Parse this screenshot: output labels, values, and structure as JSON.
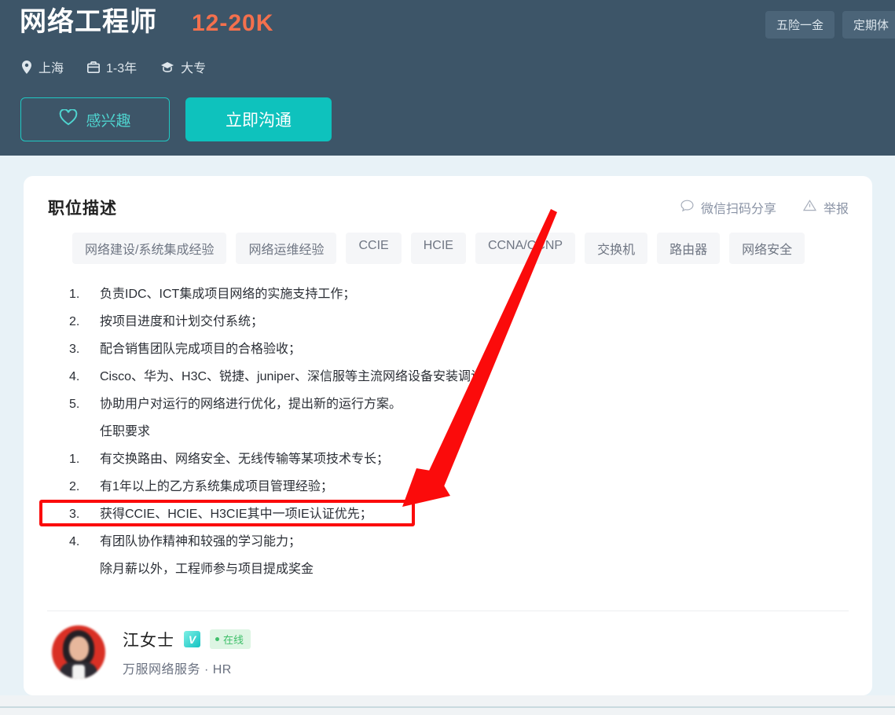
{
  "header": {
    "job_title": "网络工程师",
    "salary": "12-20K",
    "meta": [
      {
        "icon": "location-pin-icon",
        "label": "上海"
      },
      {
        "icon": "briefcase-icon",
        "label": "1-3年"
      },
      {
        "icon": "graduation-cap-icon",
        "label": "大专"
      }
    ],
    "benefit_badges": [
      "五险一金",
      "定期体"
    ],
    "interest_button": "感兴趣",
    "chat_button": "立即沟通",
    "bg_color": "#3d5568",
    "salary_color": "#f4704d",
    "accent_color": "#0ec2bd"
  },
  "card": {
    "section_title": "职位描述",
    "actions": [
      {
        "icon": "chat-bubble-icon",
        "label": "微信扫码分享"
      },
      {
        "icon": "warning-triangle-icon",
        "label": "举报"
      }
    ],
    "tags": [
      "网络建设/系统集成经验",
      "网络运维经验",
      "CCIE",
      "HCIE",
      "CCNA/CCNP",
      "交换机",
      "路由器",
      "网络安全"
    ],
    "description_lines": [
      {
        "num": "1.",
        "text": "负责IDC、ICT集成项目网络的实施支持工作；"
      },
      {
        "num": "2.",
        "text": "按项目进度和计划交付系统；"
      },
      {
        "num": "3.",
        "text": "配合销售团队完成项目的合格验收；"
      },
      {
        "num": "4.",
        "text": "Cisco、华为、H3C、锐捷、juniper、深信服等主流网络设备安装调试；"
      },
      {
        "num": "5.",
        "text": "协助用户对运行的网络进行优化，提出新的运行方案。"
      },
      {
        "num": "",
        "text": "任职要求"
      },
      {
        "num": "1.",
        "text": "有交换路由、网络安全、无线传输等某项技术专长；"
      },
      {
        "num": "2.",
        "text": "有1年以上的乙方系统集成项目管理经验；"
      },
      {
        "num": "3.",
        "text": "获得CCIE、HCIE、H3CIE其中一项IE认证优先；"
      },
      {
        "num": "4.",
        "text": "有团队协作精神和较强的学习能力；"
      },
      {
        "num": "",
        "text": "除月薪以外，工程师参与项目提成奖金"
      }
    ],
    "hr": {
      "name": "江女士",
      "verified_badge": "V",
      "status": "在线",
      "company_role": "万服网络服务 · HR"
    }
  },
  "annotation": {
    "color": "#fb0b0b",
    "highlight_target": "获得CCIE、HCIE、H3CIE其中一项IE认证优先；"
  }
}
